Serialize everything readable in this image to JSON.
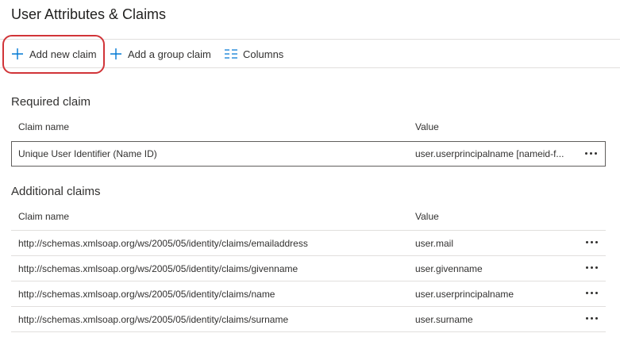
{
  "page": {
    "title": "User Attributes & Claims"
  },
  "toolbar": {
    "add_new_claim": "Add new claim",
    "add_group_claim": "Add a group claim",
    "columns": "Columns"
  },
  "required": {
    "title": "Required claim",
    "col_name": "Claim name",
    "col_value": "Value",
    "rows": [
      {
        "name": "Unique User Identifier (Name ID)",
        "value": "user.userprincipalname [nameid-f..."
      }
    ]
  },
  "additional": {
    "title": "Additional claims",
    "col_name": "Claim name",
    "col_value": "Value",
    "rows": [
      {
        "name": "http://schemas.xmlsoap.org/ws/2005/05/identity/claims/emailaddress",
        "value": "user.mail"
      },
      {
        "name": "http://schemas.xmlsoap.org/ws/2005/05/identity/claims/givenname",
        "value": "user.givenname"
      },
      {
        "name": "http://schemas.xmlsoap.org/ws/2005/05/identity/claims/name",
        "value": "user.userprincipalname"
      },
      {
        "name": "http://schemas.xmlsoap.org/ws/2005/05/identity/claims/surname",
        "value": "user.surname"
      }
    ]
  },
  "colors": {
    "accent": "#0078d4",
    "highlight": "#d13438"
  },
  "icons": {
    "add": "plus-icon",
    "columns": "columns-icon",
    "more": "more-dots-icon"
  }
}
